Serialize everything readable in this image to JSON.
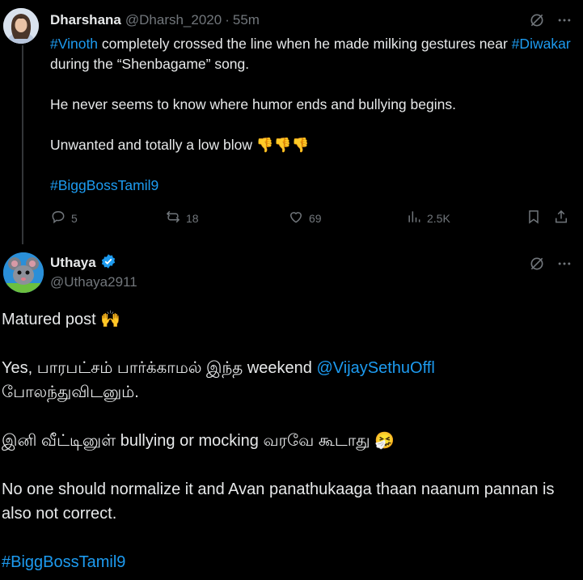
{
  "colors": {
    "background": "#000000",
    "text": "#e7e9ea",
    "muted": "#71767b",
    "link": "#1d9bf0",
    "thread_line": "#333639"
  },
  "parent_tweet": {
    "name": "Dharshana",
    "handle": "@Dharsh_2020",
    "separator": "·",
    "time": "55m",
    "line1_tag1": "#Vinoth",
    "line1_text": " completely crossed the line when he made milking gestures near ",
    "line1_tag2": "#Diwakar",
    "line1_text2": " during the “Shenbagame” song.",
    "line2": "He never seems to know where humor ends and bullying begins.",
    "line3": "Unwanted and  totally a low blow 👎👎👎",
    "hashtag": "#BiggBossTamil9",
    "replies": "5",
    "reposts": "18",
    "likes": "69",
    "views": "2.5K",
    "icons": [
      "grok-icon",
      "more-icon",
      "reply-icon",
      "repost-icon",
      "like-icon",
      "views-icon",
      "bookmark-icon",
      "share-icon"
    ]
  },
  "main_tweet": {
    "name": "Uthaya",
    "handle": "@Uthaya2911",
    "line1": "Matured post 🙌",
    "line2_text": "Yes, பாரபட்சம் பார்க்காமல் இந்த weekend ",
    "line2_mention": "@VijaySethuOffl",
    "line2_cont": "போலந்துவிடனும்.",
    "line3": "இனி வீட்டினுள் bullying or mocking வரவே கூடாது 🤧",
    "line4": "No one should normalize it and Avan panathukaaga thaan naanum pannan is also not correct.",
    "hashtag": "#BiggBossTamil9",
    "icons": [
      "verified-icon",
      "grok-icon",
      "more-icon"
    ]
  }
}
